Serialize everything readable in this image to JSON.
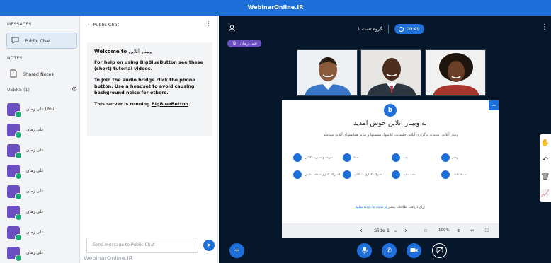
{
  "topbar": {
    "title": "WebinarOnline.IR"
  },
  "sidebar": {
    "messages_label": "MESSAGES",
    "public_chat": "Public Chat",
    "notes_label": "NOTES",
    "shared_notes": "Shared Notes",
    "users_label": "USERS (1)",
    "users": [
      "علی زمان (You)",
      "علی زمان",
      "علی زمان",
      "علی زمان",
      "علی زمان",
      "علی زمان",
      "علی زمان",
      "علی زمان"
    ]
  },
  "chat": {
    "header": "Public Chat",
    "welcome_title_prefix": "Welcome to",
    "welcome_title_name": "وبینار آنلاین",
    "help_pre": "For help on using BigBlueButton see these (short)",
    "help_link": "tutorial videos",
    "help_post": ".",
    "audio_text": "To join the audio bridge click the phone button. Use a headset to avoid causing background noise for others.",
    "server_pre": "This server is running",
    "server_link": "BigBlueButton",
    "server_post": ".",
    "input_placeholder": "Send message to Public Chat",
    "watermark": "WebinarOnline.IR"
  },
  "main": {
    "room_name": "گروه تست ۱",
    "recording_time": "00:49",
    "presenter_tag": "علی زمان",
    "slide": {
      "title": "به وبینار آنلاین خوش آمدید",
      "subtitle": "وبینار آنلاین، سامانه برگزاری آنلاین جلسات، کلاسها، نشستها و سایر همایشهای آنلاین میباشد",
      "features": [
        "تعریف و مدیریت کلاس",
        "صدا",
        "چت",
        "ویدئو",
        "اشتراک گذاری صفحه نمایش",
        "اشتراک گذاری دسکتاپ",
        "تخته سفید",
        "ضبط جلسه"
      ],
      "footer_pre": "برای دریافت اطلاعات بیشتر",
      "footer_link": "از سایت ما بازدید نمایید",
      "slide_label": "Slide 1",
      "zoom": "100%"
    }
  },
  "colors": {
    "brand_blue": "#1e6fd9",
    "dark_bg": "#06172c",
    "avatar_purple": "#6b4fc0",
    "status_green": "#19a974"
  }
}
